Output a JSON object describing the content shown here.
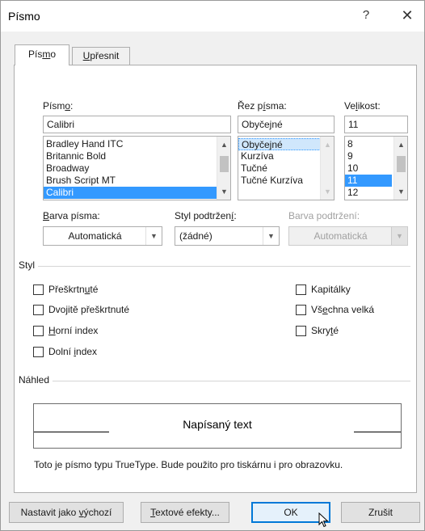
{
  "window": {
    "title": "Písmo",
    "help_glyph": "?",
    "close_glyph": "✕"
  },
  "tabs": [
    {
      "label_pre": "Pís",
      "label_u": "m",
      "label_post": "o",
      "active": true
    },
    {
      "label_pre": "",
      "label_u": "U",
      "label_post": "přesnit",
      "active": false
    }
  ],
  "font": {
    "label_pre": "Písm",
    "label_u": "o",
    "label_post": ":",
    "value": "Calibri",
    "list": [
      "Bradley Hand ITC",
      "Britannic Bold",
      "Broadway",
      "Brush Script MT",
      "Calibri"
    ],
    "selected_index": 4
  },
  "style": {
    "label_pre": "Řez p",
    "label_u": "í",
    "label_post": "sma:",
    "value": "Obyčejné",
    "list": [
      "Obyčejné",
      "Kurzíva",
      "Tučné",
      "Tučné Kurzíva"
    ],
    "selected_index": 0
  },
  "size": {
    "label_pre": "Ve",
    "label_u": "l",
    "label_post": "ikost:",
    "value": "11",
    "list": [
      "8",
      "9",
      "10",
      "11",
      "12"
    ],
    "selected_index": 3
  },
  "font_color": {
    "label_pre": "",
    "label_u": "B",
    "label_post": "arva písma:",
    "value": "Automatická"
  },
  "underline_style": {
    "label_pre": "Styl podtržen",
    "label_u": "í",
    "label_post": ":",
    "value": "(žádné)"
  },
  "underline_color": {
    "label": "Barva podtržení:",
    "value": "Automatická",
    "disabled": true
  },
  "effects": {
    "group_label": "Styl",
    "left": [
      {
        "pre": "Přeškrtn",
        "u": "u",
        "post": "té",
        "checked": false
      },
      {
        "pre": "Dvojitě přeškrtnuté",
        "u": "",
        "post": "",
        "checked": false
      },
      {
        "pre": "",
        "u": "H",
        "post": "orní index",
        "checked": false
      },
      {
        "pre": "Dolní ",
        "u": "i",
        "post": "ndex",
        "checked": false
      }
    ],
    "right": [
      {
        "pre": "Kapitálky",
        "u": "",
        "post": "",
        "checked": false
      },
      {
        "pre": "Vš",
        "u": "e",
        "post": "chna velká",
        "checked": false
      },
      {
        "pre": "Skry",
        "u": "t",
        "post": "é",
        "checked": false
      }
    ]
  },
  "preview": {
    "group_label": "Náhled",
    "sample": "Napísaný text",
    "description": "Toto je písmo typu TrueType. Bude použito pro tiskárnu i pro obrazovku."
  },
  "buttons": {
    "set_default": {
      "pre": "Nastavit jako ",
      "u": "v",
      "post": "ýchozí"
    },
    "text_effects": {
      "pre": "",
      "u": "T",
      "post": "extové efekty..."
    },
    "ok": "OK",
    "cancel": "Zrušit"
  },
  "colors": {
    "selection": "#3399ff",
    "default_button_border": "#0078d7"
  }
}
